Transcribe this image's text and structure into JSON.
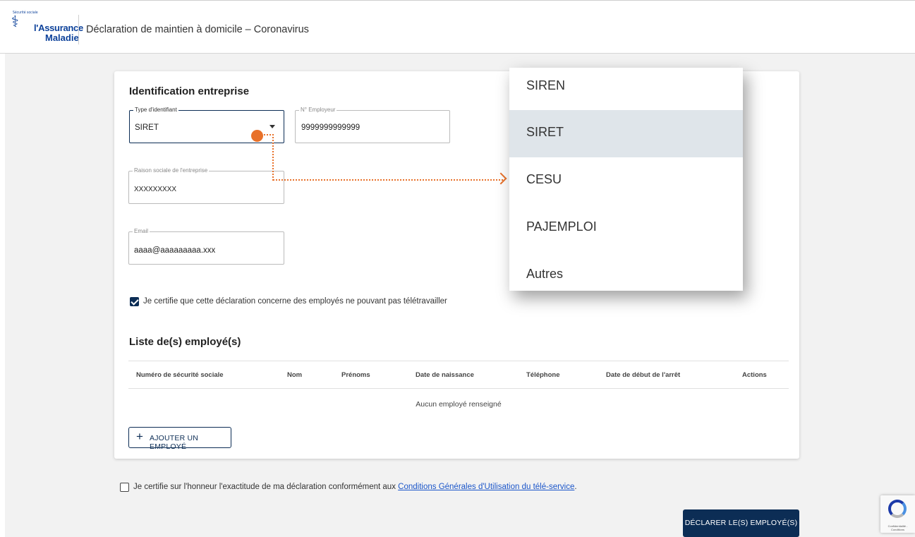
{
  "header": {
    "logo_line1": "l'Assurance",
    "logo_line2": "Maladie",
    "logo_arc": "Sécurité sociale",
    "title": "Déclaration de maintien à domicile – Coronavirus"
  },
  "identification": {
    "section_title": "Identification entreprise",
    "type_identifiant": {
      "label": "Type d'identifiant",
      "value": "SIRET"
    },
    "numero_employeur": {
      "label": "N° Employeur",
      "value": "9999999999999"
    },
    "raison_sociale": {
      "label": "Raison sociale de l'entreprise",
      "value": "XXXXXXXXX"
    },
    "email": {
      "label": "Email",
      "value": "aaaa@aaaaaaaaa.xxx"
    },
    "certify_telework": {
      "label": "Je certifie que cette déclaration concerne des employés ne pouvant pas télétravailler",
      "checked": true
    }
  },
  "employees": {
    "section_title": "Liste de(s) employé(s)",
    "columns": [
      "Numéro de sécurité sociale",
      "Nom",
      "Prénoms",
      "Date de naissance",
      "Téléphone",
      "Date de début de l'arrêt",
      "Actions"
    ],
    "empty_message": "Aucun employé renseigné",
    "add_button": "AJOUTER UN EMPLOYÉ"
  },
  "footer": {
    "honor_prefix": "Je certifie sur l'honneur l'exactitude de ma déclaration conformément aux ",
    "honor_link": "Conditions Générales d'Utilisation du télé-service",
    "honor_suffix": ".",
    "honor_checked": false,
    "submit_button": "DÉCLARER LE(S) EMPLOYÉ(S)"
  },
  "dropdown": {
    "options": [
      "SIREN",
      "SIRET",
      "CESU",
      "PAJEMPLOI",
      "Autres"
    ],
    "selected": "SIRET"
  },
  "recaptcha": {
    "text": "Confidentialité - Conditions"
  },
  "colors": {
    "primary": "#0c2d55",
    "brand": "#0c419a",
    "annotation": "#e8712a",
    "selected_option": "#dfe5ea"
  }
}
